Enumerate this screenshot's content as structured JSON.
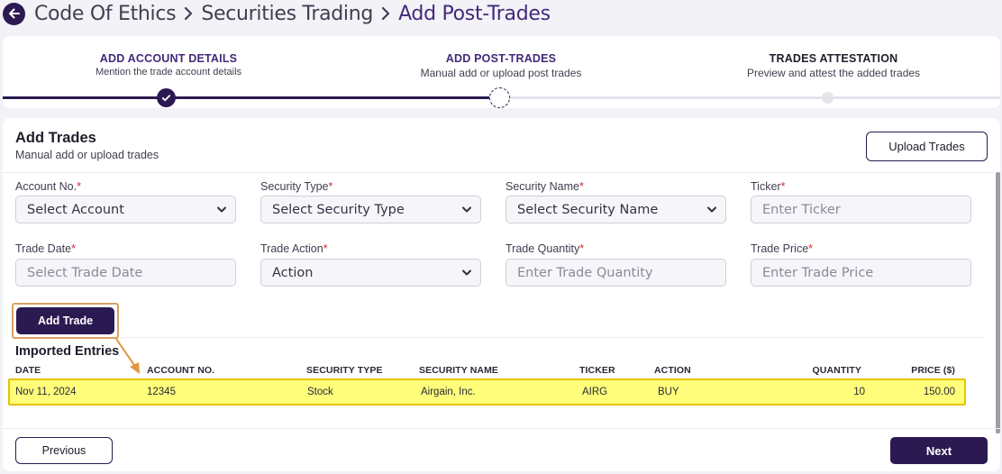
{
  "breadcrumb": {
    "items": [
      "Code Of Ethics",
      "Securities Trading",
      "Add Post-Trades"
    ]
  },
  "stepper": {
    "steps": [
      {
        "title": "ADD ACCOUNT DETAILS",
        "subtitle": "Mention the trade account details",
        "state": "complete"
      },
      {
        "title": "ADD POST-TRADES",
        "subtitle": "Manual add or upload post trades",
        "state": "current"
      },
      {
        "title": "TRADES ATTESTATION",
        "subtitle": "Preview and attest the added trades",
        "state": "pending"
      }
    ]
  },
  "add_trades": {
    "title": "Add Trades",
    "subtitle": "Manual add or upload trades",
    "upload_label": "Upload Trades",
    "fields": {
      "account_no": {
        "label": "Account No.",
        "value": "Select Account"
      },
      "security_type": {
        "label": "Security Type",
        "value": "Select Security Type"
      },
      "security_name": {
        "label": "Security Name",
        "value": "Select Security Name"
      },
      "ticker": {
        "label": "Ticker",
        "placeholder": "Enter Ticker"
      },
      "trade_date": {
        "label": "Trade Date",
        "placeholder": "Select Trade Date"
      },
      "trade_action": {
        "label": "Trade Action",
        "value": "Action"
      },
      "trade_quantity": {
        "label": "Trade Quantity",
        "placeholder": "Enter Trade Quantity"
      },
      "trade_price": {
        "label": "Trade Price",
        "placeholder": "Enter Trade Price"
      }
    },
    "required_mark": "*",
    "add_trade_label": "Add Trade"
  },
  "imported": {
    "title": "Imported Entries",
    "columns": [
      "DATE",
      "ACCOUNT NO.",
      "SECURITY TYPE",
      "SECURITY NAME",
      "TICKER",
      "ACTION",
      "QUANTITY",
      "PRICE ($)"
    ],
    "rows": [
      [
        "Nov 11, 2024",
        "12345",
        "Stock",
        "Airgain, Inc.",
        "AIRG",
        "BUY",
        "10",
        "150.00"
      ]
    ]
  },
  "footer": {
    "previous_label": "Previous",
    "next_label": "Next"
  },
  "colors": {
    "brand": "#2b1a52",
    "accent_purple": "#43297a",
    "highlight": "#fffd7a",
    "annotation": "#d8a062",
    "required": "#d32f2f"
  },
  "icons": {
    "back": "arrow-left-icon",
    "separator": "chevron-right-icon",
    "dropdown": "chevron-down-icon",
    "complete": "check-icon"
  }
}
